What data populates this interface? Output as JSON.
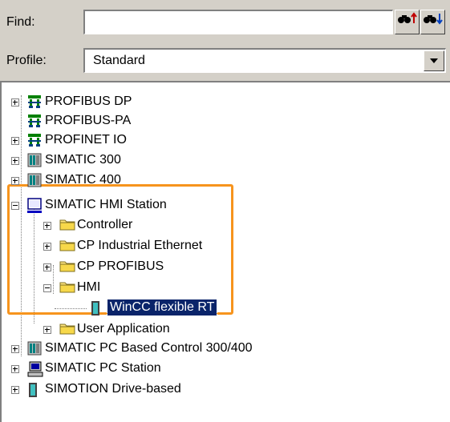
{
  "find": {
    "label": "Find:",
    "value": "",
    "btn_up": "m↑",
    "btn_down": "m↓"
  },
  "profile": {
    "label": "Profile:",
    "value": "Standard"
  },
  "tree": {
    "items": [
      {
        "label": "PROFIBUS DP",
        "icon": "network-icon"
      },
      {
        "label": "PROFIBUS-PA",
        "icon": "network-icon"
      },
      {
        "label": "PROFINET IO",
        "icon": "network-icon"
      },
      {
        "label": "SIMATIC 300",
        "icon": "rack-icon"
      },
      {
        "label": "SIMATIC 400",
        "icon": "rack-icon"
      },
      {
        "label": "SIMATIC HMI Station",
        "icon": "monitor-icon"
      },
      {
        "label": "Controller",
        "icon": "folder-icon"
      },
      {
        "label": "CP Industrial Ethernet",
        "icon": "folder-icon"
      },
      {
        "label": "CP PROFIBUS",
        "icon": "folder-icon"
      },
      {
        "label": "HMI",
        "icon": "folder-icon"
      },
      {
        "label": "WinCC flexible RT",
        "icon": "device-icon"
      },
      {
        "label": "User Application",
        "icon": "folder-icon"
      },
      {
        "label": "SIMATIC PC Based Control 300/400",
        "icon": "rack-icon"
      },
      {
        "label": "SIMATIC PC Station",
        "icon": "pc-icon"
      },
      {
        "label": "SIMOTION Drive-based",
        "icon": "device-icon"
      }
    ]
  },
  "colors": {
    "highlight": "#f7941d",
    "selection": "#0a246a",
    "panel": "#d4d0c8"
  }
}
